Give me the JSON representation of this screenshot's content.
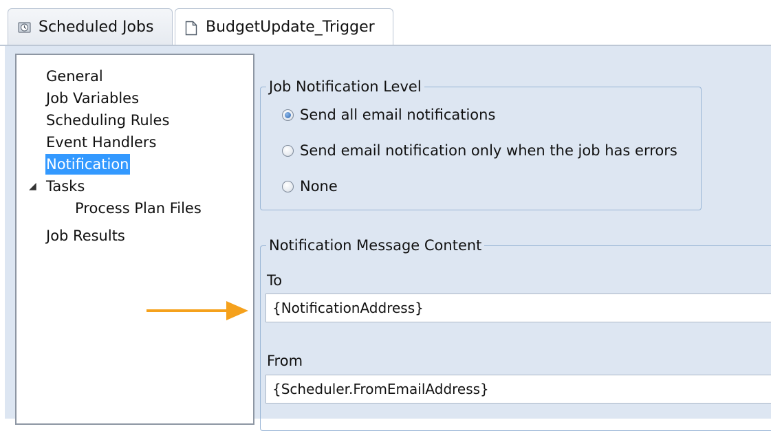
{
  "tabs": [
    {
      "label": "Scheduled Jobs",
      "icon": "scheduled-jobs-icon",
      "active": false
    },
    {
      "label": "BudgetUpdate_Trigger",
      "icon": "document-icon",
      "active": true
    }
  ],
  "tree": {
    "items": [
      {
        "label": "General"
      },
      {
        "label": "Job Variables"
      },
      {
        "label": "Scheduling Rules"
      },
      {
        "label": "Event Handlers"
      },
      {
        "label": "Notification",
        "selected": true
      },
      {
        "label": "Tasks",
        "expanded": true
      },
      {
        "label": "Process Plan Files"
      },
      {
        "label": "Job Results"
      }
    ]
  },
  "notification_level": {
    "title": "Job Notification Level",
    "options": [
      {
        "label": "Send all email notifications",
        "checked": true
      },
      {
        "label": "Send email notification only when the job has errors",
        "checked": false
      },
      {
        "label": "None",
        "checked": false
      }
    ]
  },
  "message_content": {
    "title": "Notification Message Content",
    "to_label": "To",
    "to_value": "{NotificationAddress}",
    "from_label": "From",
    "from_value": "{Scheduler.FromEmailAddress}"
  },
  "colors": {
    "accent_arrow": "#f5a11c",
    "selection": "#3399ff",
    "panel_background": "#dde6f2"
  }
}
